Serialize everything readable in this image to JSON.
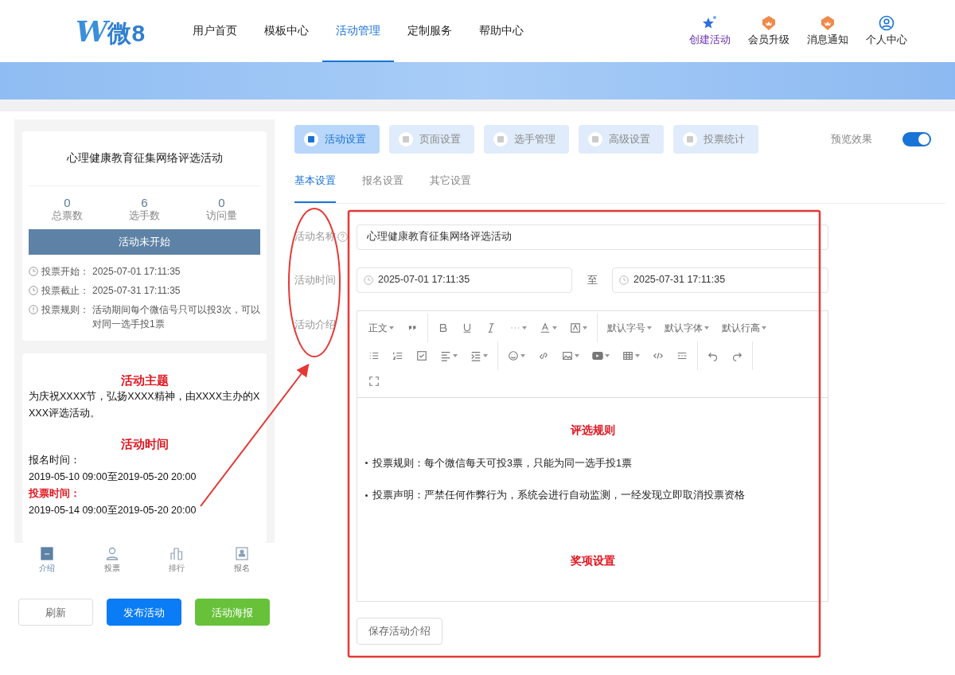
{
  "logo": {
    "mark": "W",
    "text": "微8"
  },
  "main_nav": [
    {
      "label": "用户首页",
      "selected": false
    },
    {
      "label": "模板中心",
      "selected": false
    },
    {
      "label": "活动管理",
      "selected": true
    },
    {
      "label": "定制服务",
      "selected": false
    },
    {
      "label": "帮助中心",
      "selected": false
    }
  ],
  "header_actions": [
    {
      "label": "创建活动",
      "highlighted": true
    },
    {
      "label": "会员升级",
      "highlighted": false
    },
    {
      "label": "消息通知",
      "highlighted": false
    },
    {
      "label": "个人中心",
      "highlighted": false
    }
  ],
  "summary_card": {
    "title": "心理健康教育征集网络评选活动",
    "stats": [
      {
        "value": "0",
        "label": "总票数"
      },
      {
        "value": "6",
        "label": "选手数"
      },
      {
        "value": "0",
        "label": "访问量"
      }
    ],
    "status": "活动未开始",
    "info": [
      {
        "kind": "clock",
        "label": "投票开始：",
        "value": "2025-07-01 17:11:35"
      },
      {
        "kind": "clock",
        "label": "投票截止：",
        "value": "2025-07-31 17:11:35"
      },
      {
        "kind": "info",
        "label": "投票规则：",
        "value": "活动期间每个微信号只可以投3次，可以对同一选手投1票"
      }
    ]
  },
  "preview": [
    {
      "kind": "heading",
      "text": "活动主题"
    },
    {
      "kind": "paragraph",
      "text": "为庆祝XXXX节，弘扬XXXX精神，由XXXX主办的XXXX评选活动。"
    },
    {
      "kind": "heading",
      "text": "活动时间"
    },
    {
      "kind": "paragraph",
      "text": "报名时间："
    },
    {
      "kind": "paragraph",
      "text": "2019-05-10 09:00至2019-05-20 20:00"
    },
    {
      "kind": "label",
      "text": "投票时间："
    },
    {
      "kind": "paragraph",
      "text": "2019-05-14 09:00至2019-05-20 20:00"
    }
  ],
  "preview_nav": [
    {
      "label": "介绍",
      "selected": true
    },
    {
      "label": "投票",
      "selected": false
    },
    {
      "label": "排行",
      "selected": false
    },
    {
      "label": "报名",
      "selected": false
    }
  ],
  "action_buttons": [
    {
      "kind": "default",
      "label": "刷新"
    },
    {
      "kind": "primary",
      "label": "发布活动"
    },
    {
      "kind": "success",
      "label": "活动海报"
    }
  ],
  "settings_tabs": [
    {
      "label": "活动设置",
      "selected": true
    },
    {
      "label": "页面设置",
      "selected": false
    },
    {
      "label": "选手管理",
      "selected": false
    },
    {
      "label": "高级设置",
      "selected": false
    },
    {
      "label": "投票统计",
      "selected": false
    }
  ],
  "preview_toggle": {
    "label": "预览效果",
    "on": true
  },
  "sub_tabs": [
    {
      "label": "基本设置",
      "selected": true
    },
    {
      "label": "报名设置",
      "selected": false
    },
    {
      "label": "其它设置",
      "selected": false
    }
  ],
  "form": {
    "name_label": "活动名称",
    "name_value": "心理健康教育征集网络评选活动",
    "time_label": "活动时间",
    "start": "2025-07-01 17:11:35",
    "separator": "至",
    "end": "2025-07-31 17:11:35",
    "intro_label": "活动介绍",
    "toolbar_labels": [
      "正文",
      "默认字号",
      "默认字体",
      "默认行高"
    ],
    "editor": [
      {
        "kind": "heading",
        "text": "评选规则"
      },
      {
        "kind": "bullet",
        "text": "投票规则：每个微信每天可投3票，只能为同一选手投1票"
      },
      {
        "kind": "bullet",
        "text": "投票声明：严禁任何作弊行为，系统会进行自动监测，一经发现立即取消投票资格"
      },
      {
        "kind": "heading",
        "text": "奖项设置"
      }
    ],
    "save_button": "保存活动介绍"
  }
}
